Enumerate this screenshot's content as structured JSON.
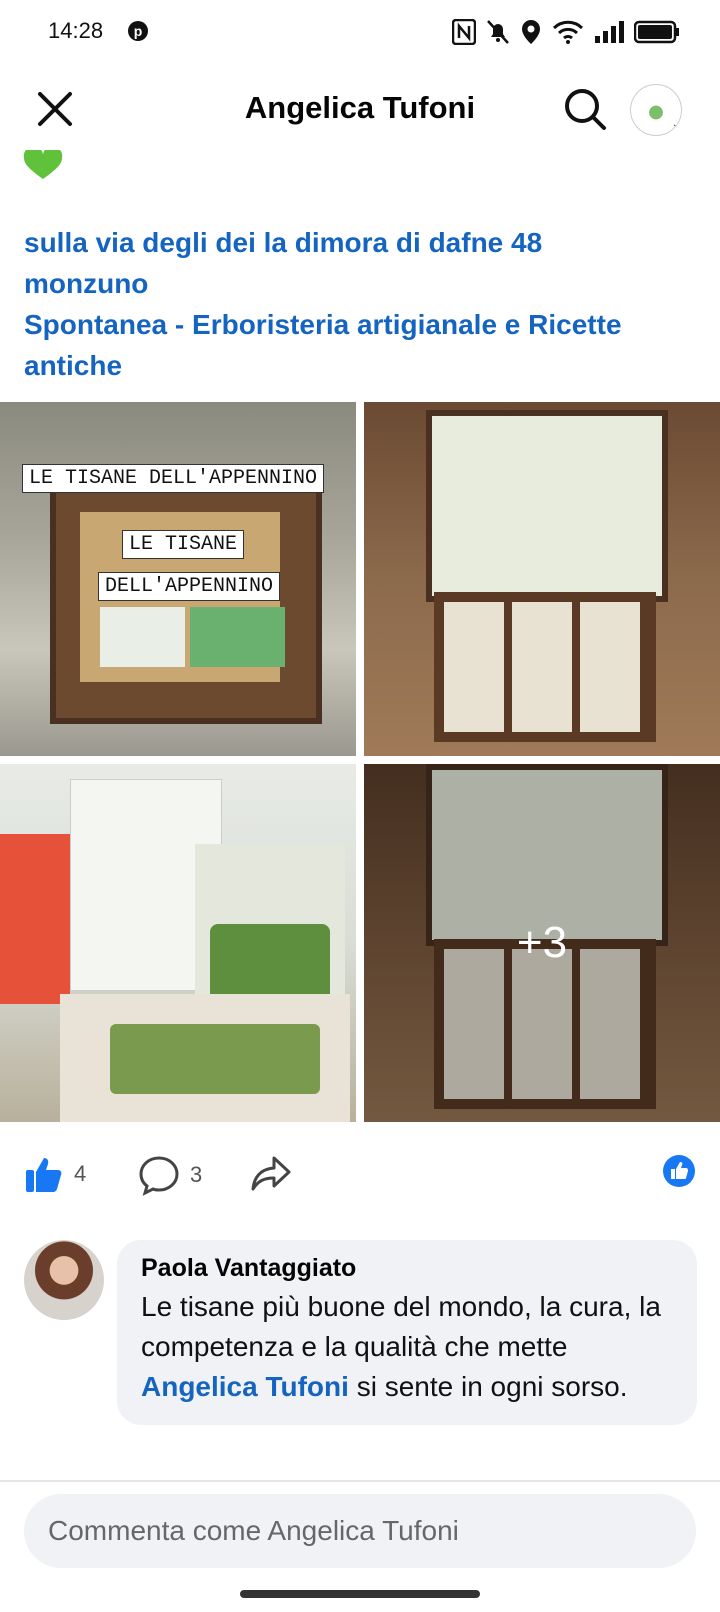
{
  "status": {
    "time": "14:28",
    "pinterest_glyph": "p"
  },
  "header": {
    "title": "Angelica Tufoni"
  },
  "post": {
    "location_line1": "sulla via degli dei la dimora di dafne 48",
    "location_line2": "monzuno",
    "page_line1": "Spontanea -  Erboristeria artigianale e Ricette",
    "page_line2": "antiche",
    "photos": {
      "photo1_label1": "LE TISANE DELL'APPENNINO",
      "photo1_label2": "LE TISANE",
      "photo1_label3": "DELL'APPENNINO",
      "photo4_more": "+3"
    },
    "reactions": {
      "likes": "4",
      "comments": "3"
    }
  },
  "comment": {
    "author": "Paola Vantaggiato",
    "text_before": "Le tisane più buone del mondo, la cura, la competenza e la qualità che mette ",
    "mention": "Angelica Tufoni",
    "text_after": " si sente in ogni sorso."
  },
  "composer": {
    "placeholder": "Commenta come Angelica Tufoni"
  },
  "colors": {
    "link": "#1565c0",
    "like": "#1877f2",
    "bubble": "#f0f2f5"
  }
}
